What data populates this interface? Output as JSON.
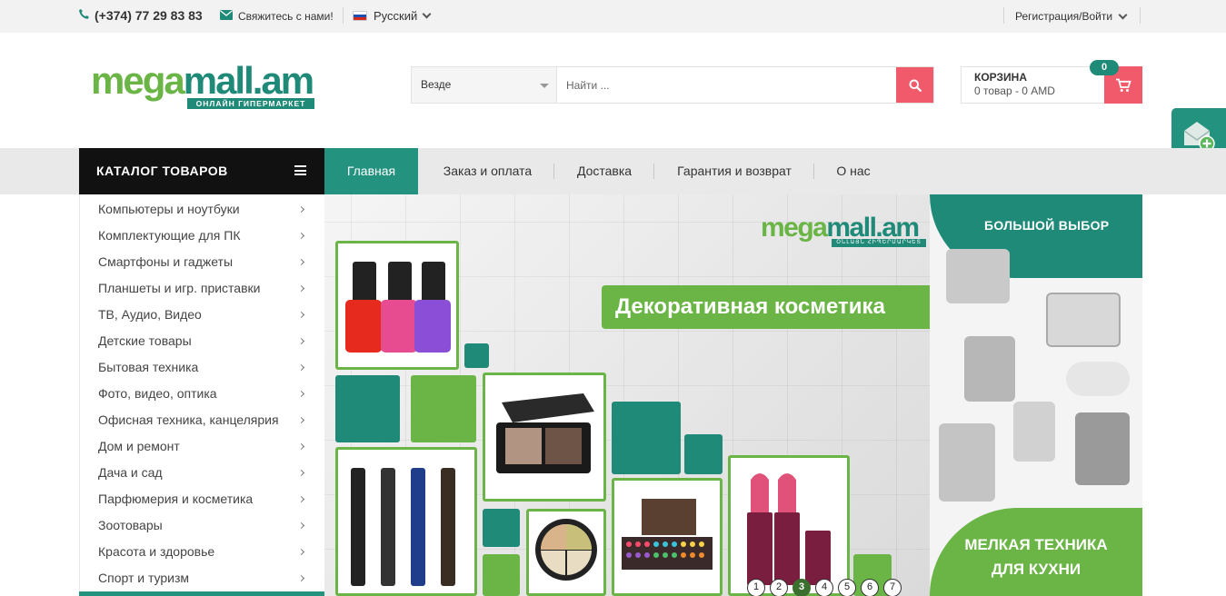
{
  "topbar": {
    "phone": "(+374) 77 29 83 83",
    "contact": "Свяжитесь с нами!",
    "language": "Русский",
    "login": "Регистрация/Войти"
  },
  "logo": {
    "name_part1": "mega",
    "name_part2": "mall.am",
    "subtitle": "ОНЛАЙН ГИПЕРМАРКЕТ"
  },
  "search": {
    "category": "Везде",
    "placeholder": "Найти ..."
  },
  "cart": {
    "title": "КОРЗИНА",
    "summary": "0 товар - 0 AMD",
    "count": "0"
  },
  "catalog": {
    "title": "КАТАЛОГ ТОВАРОВ"
  },
  "nav": {
    "items": [
      {
        "label": "Главная",
        "active": true
      },
      {
        "label": "Заказ и оплата"
      },
      {
        "label": "Доставка"
      },
      {
        "label": "Гарантия и возврат"
      },
      {
        "label": "О нас"
      }
    ]
  },
  "categories": [
    "Компьютеры и ноутбуки",
    "Комплектующие для ПК",
    "Смартфоны и гаджеты",
    "Планшеты и игр. приставки",
    "ТВ, Аудио, Видео",
    "Детские товары",
    "Бытовая техника",
    "Фото, видео, оптика",
    "Офисная техника, канцелярия",
    "Дом и ремонт",
    "Дача и сад",
    "Парфюмерия и косметика",
    "Зоотовары",
    "Красота и здоровье",
    "Спорт и туризм"
  ],
  "banner": {
    "logo_part1": "mega",
    "logo_part2": "mall.am",
    "logo_sub": "ՕՆԼԱՅՆ ՀԻՊԵՐՄԱՐԿԵՏ",
    "headline": "Декоративная косметика",
    "right_top": "БОЛЬШОЙ ВЫБОР",
    "right_bottom_line1": "МЕЛКАЯ ТЕХНИКА",
    "right_bottom_line2": "ДЛЯ КУХНИ",
    "slides": [
      "1",
      "2",
      "3",
      "4",
      "5",
      "6",
      "7"
    ],
    "active_slide": "3"
  },
  "colors": {
    "teal": "#1f8a78",
    "green": "#6ab546",
    "pink": "#f05a6a",
    "dark": "#111111"
  }
}
